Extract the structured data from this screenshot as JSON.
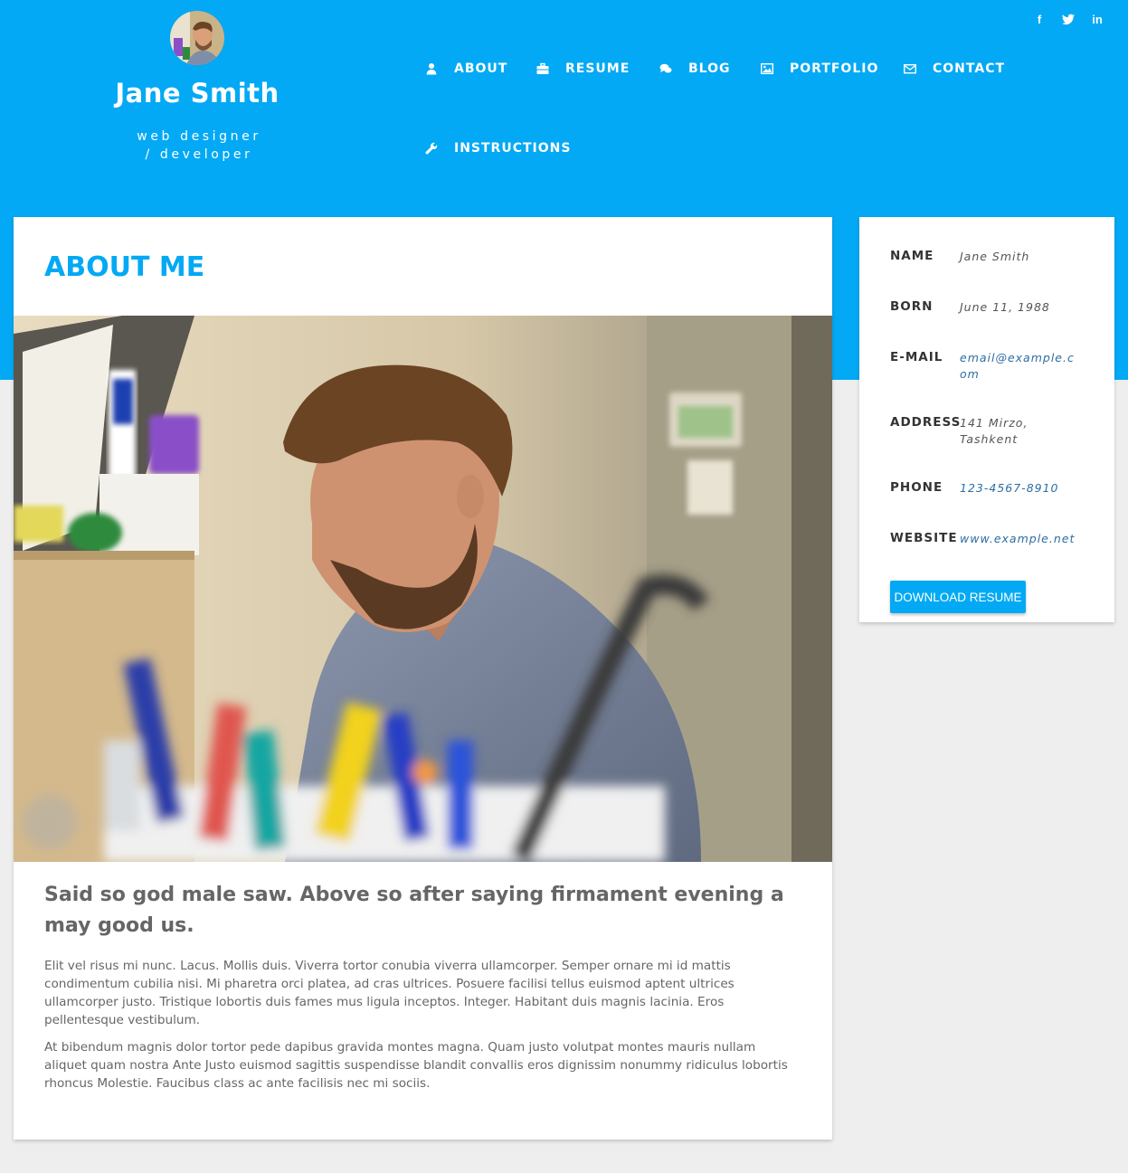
{
  "profile": {
    "name": "Jane Smith",
    "title_line1": "web designer",
    "title_line2": "/ developer"
  },
  "social": {
    "facebook": "f",
    "twitter": "t",
    "linkedin": "in"
  },
  "nav": {
    "about": "ABOUT",
    "resume": "RESUME",
    "blog": "BLOG",
    "portfolio": "PORTFOLIO",
    "contact": "CONTACT",
    "instructions": "INSTRUCTIONS"
  },
  "icons": {
    "about": "user-icon",
    "resume": "briefcase-icon",
    "blog": "comments-icon",
    "portfolio": "picture-icon",
    "contact": "envelope-icon",
    "instructions": "wrench-icon"
  },
  "about": {
    "title": "ABOUT ME",
    "headline": "Said so god male saw. Above so after saying firmament evening a may good us.",
    "paragraph1": "Elit vel risus mi nunc. Lacus. Mollis duis. Viverra tortor conubia viverra ullamcorper. Semper ornare mi id mattis condimentum cubilia nisi. Mi pharetra orci platea, ad cras ultrices. Posuere facilisi tellus euismod aptent ultrices ullamcorper justo. Tristique lobortis duis fames mus ligula inceptos. Integer. Habitant duis magnis lacinia. Eros pellentesque vestibulum.",
    "paragraph2": "At bibendum magnis dolor tortor pede dapibus gravida montes magna. Quam justo volutpat montes mauris nullam aliquet quam nostra Ante Justo euismod sagittis suspendisse blandit convallis eros dignissim nonummy ridiculus lobortis rhoncus Molestie. Faucibus class ac ante facilisis nec mi sociis."
  },
  "info": {
    "name_label": "NAME",
    "name_value": "Jane Smith",
    "born_label": "BORN",
    "born_value": "June 11, 1988",
    "email_label": "E-MAIL",
    "email_value": "email@example.com",
    "address_label": "ADDRESS",
    "address_value": "141 Mirzo, Tashkent",
    "phone_label": "PHONE",
    "phone_value": "123-4567-8910",
    "website_label": "WEBSITE",
    "website_value": "www.example.net",
    "download_label": "DOWNLOAD RESUME"
  },
  "colors": {
    "accent": "#03a9f4",
    "background": "#eeeeee",
    "link": "#2e6da4"
  }
}
